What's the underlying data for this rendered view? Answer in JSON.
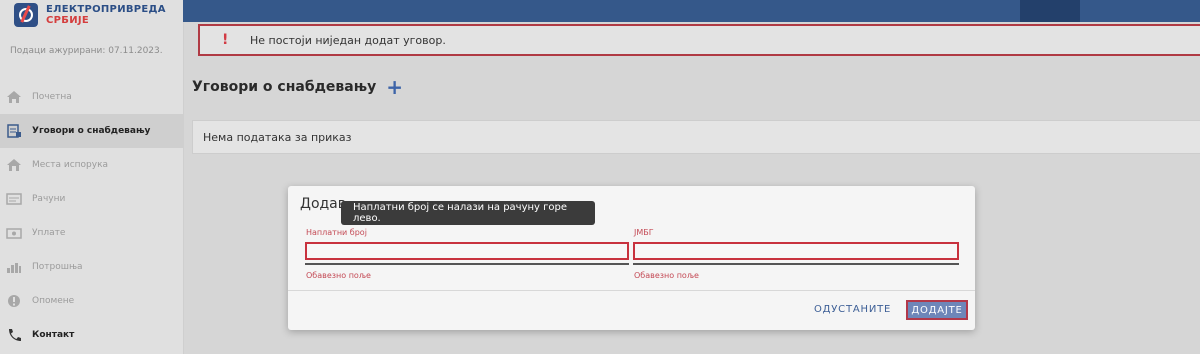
{
  "brand": {
    "line1": "ЕЛЕКТРОПРИВРЕДА",
    "line2": "СРБИЈЕ"
  },
  "sidebar": {
    "updated": "Подаци ажурирани: 07.11.2023.",
    "items": [
      {
        "label": "Почетна",
        "icon": "home-icon"
      },
      {
        "label": "Уговори о снабдевању",
        "icon": "contract-icon"
      },
      {
        "label": "Места испорука",
        "icon": "location-icon"
      },
      {
        "label": "Рачуни",
        "icon": "bill-icon"
      },
      {
        "label": "Уплате",
        "icon": "payment-icon"
      },
      {
        "label": "Потрошња",
        "icon": "consumption-icon"
      },
      {
        "label": "Опомене",
        "icon": "warning-icon"
      },
      {
        "label": "Контакт",
        "icon": "phone-icon"
      }
    ]
  },
  "alert": {
    "icon": "!",
    "text": "Не постоји ниједан додат уговор."
  },
  "section": {
    "title": "Уговори о снабдевању",
    "add_icon": "+"
  },
  "empty_state": {
    "text": "Нема података за приказ"
  },
  "modal": {
    "title": "Додав",
    "tooltip": "Наплатни број се налази на рачуну горе лево.",
    "fields": [
      {
        "label": "Наплатни број",
        "value": "",
        "error": "Обавезно поље"
      },
      {
        "label": "ЈМБГ",
        "value": "",
        "error": "Обавезно поље"
      }
    ],
    "cancel_label": "ОДУСТАНИТЕ",
    "submit_label": "ДОДАЈТЕ"
  },
  "colors": {
    "brand_blue": "#2b4e86",
    "brand_red": "#d43d3d",
    "error": "#c8323e",
    "primary": "#6e86b9"
  }
}
